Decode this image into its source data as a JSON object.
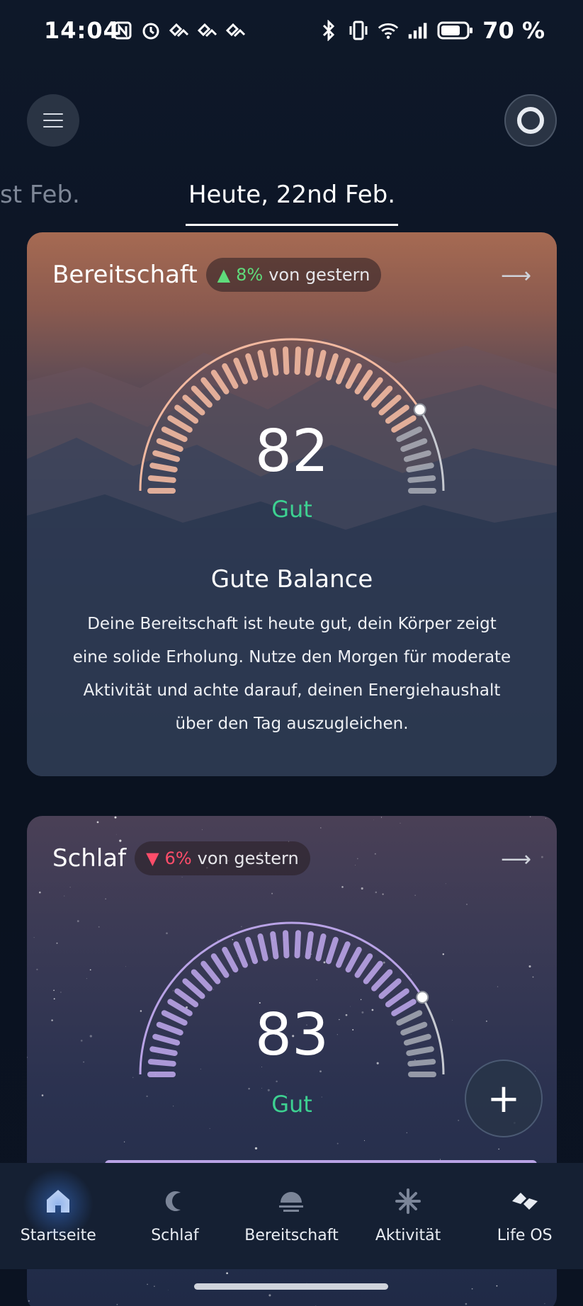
{
  "status": {
    "time": "14:04",
    "battery": "70 %"
  },
  "dates": {
    "previous": "st Feb.",
    "current": "Heute, 22nd Feb."
  },
  "readiness": {
    "title": "Bereitschaft",
    "delta": "8%",
    "delta_suffix": "von gestern",
    "score": "82",
    "score_label": "Gut",
    "score_fraction": 0.82,
    "insight_title": "Gute Balance",
    "insight_text": "Deine Bereitschaft ist heute gut, dein Körper zeigt eine solide Erholung. Nutze den Morgen für moderate Aktivität und achte darauf, deinen Energiehaushalt über den Tag auszugleichen."
  },
  "sleep": {
    "title": "Schlaf",
    "delta": "6%",
    "delta_suffix": "von gestern",
    "score": "83",
    "score_label": "Gut",
    "score_fraction": 0.83
  },
  "fab": {
    "label": "+"
  },
  "nav": {
    "items": [
      {
        "label": "Startseite",
        "icon": "home-icon"
      },
      {
        "label": "Schlaf",
        "icon": "moon-icon"
      },
      {
        "label": "Bereitschaft",
        "icon": "readiness-icon"
      },
      {
        "label": "Aktivität",
        "icon": "activity-icon"
      },
      {
        "label": "Life OS",
        "icon": "life-os-icon"
      }
    ]
  },
  "colors": {
    "accent_good": "#3dd191",
    "delta_up": "#5fdc7b",
    "delta_down": "#ff4d6a",
    "readiness_gauge": "#f2b9a0",
    "sleep_gauge": "#b9a3e6"
  }
}
